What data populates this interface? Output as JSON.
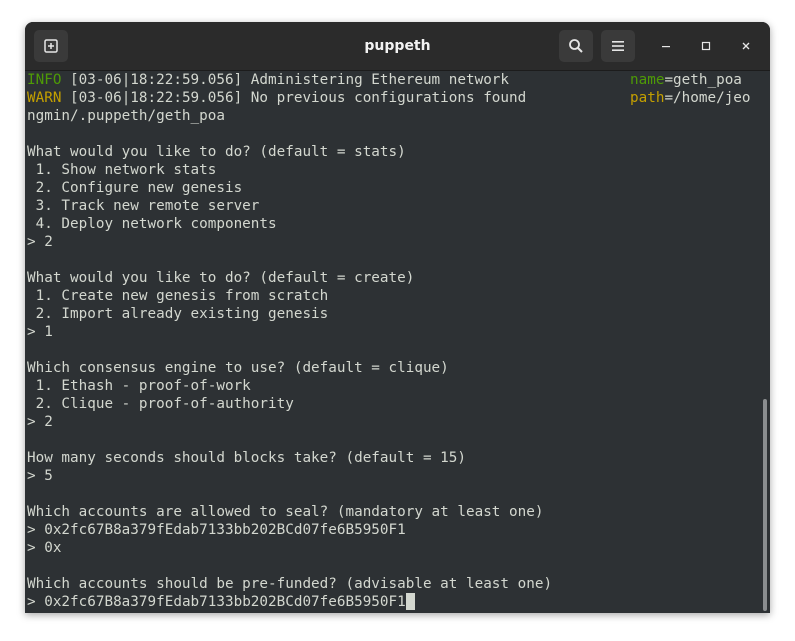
{
  "window": {
    "title": "puppeth"
  },
  "icons": {
    "new_tab": "new-tab-icon",
    "search": "search-icon",
    "menu": "hamburger-menu-icon",
    "minimize": "minimize-icon",
    "maximize": "maximize-icon",
    "close": "close-icon"
  },
  "colors": {
    "terminal_bg": "#2d3134",
    "terminal_fg": "#d3d7cf",
    "info": "#4e9a06",
    "warn": "#c4a000",
    "titlebar": "#2b2b2b"
  },
  "log": [
    {
      "level": "INFO",
      "message": " [03-06|18:22:59.056] Administering Ethereum network",
      "key": "name",
      "value": "=geth_poa"
    },
    {
      "level": "WARN",
      "message": " [03-06|18:22:59.056] No previous configurations found",
      "key": "path",
      "value": "=/home/jeo"
    }
  ],
  "output": [
    "ngmin/.puppeth/geth_poa",
    "",
    "What would you like to do? (default = stats)",
    " 1. Show network stats",
    " 2. Configure new genesis",
    " 3. Track new remote server",
    " 4. Deploy network components",
    "> 2",
    "",
    "What would you like to do? (default = create)",
    " 1. Create new genesis from scratch",
    " 2. Import already existing genesis",
    "> 1",
    "",
    "Which consensus engine to use? (default = clique)",
    " 1. Ethash - proof-of-work",
    " 2. Clique - proof-of-authority",
    "> 2",
    "",
    "How many seconds should blocks take? (default = 15)",
    "> 5",
    "",
    "Which accounts are allowed to seal? (mandatory at least one)",
    "> 0x2fc67B8a379fEdab7133bb202BCd07fe6B5950F1",
    "> 0x",
    "",
    "Which accounts should be pre-funded? (advisable at least one)"
  ],
  "input": {
    "prompt": "> ",
    "value": "0x2fc67B8a379fEdab7133bb202BCd07fe6B5950F1"
  }
}
